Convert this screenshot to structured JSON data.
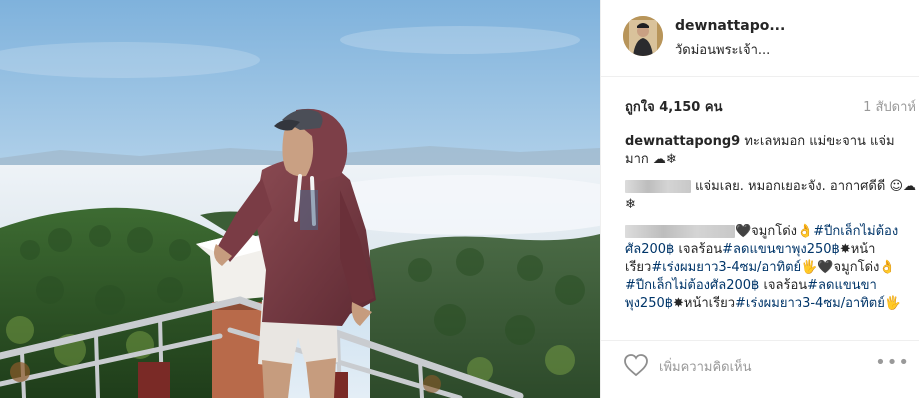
{
  "post": {
    "photo_icon": "photo",
    "username": "dewnattapo...",
    "location": "วัดม่อนพระเจ้า...",
    "likes": "ถูกใจ 4,150 คน",
    "time": "1 สัปดาห์",
    "add_comment_placeholder": "เพิ่มความคิดเห็น",
    "more_icon": "•••"
  },
  "comments": [
    {
      "user": "dewnattapong9",
      "text": " ทะเลหมอก แม่ขะจาน แจ่มมาก ☁❄"
    },
    {
      "text": "แจ่มเลย. หมอกเยอะจัง. อากาศดีดี ☺☁❄"
    },
    {
      "text1": "🖤จมูกโด่ง👌",
      "tag1": "#ปีกเล็กไม่ต้องศัล200฿",
      "text2": " เจลร้อน",
      "tag2": "#ลดแขนขาพุง250฿",
      "text3": "✸หน้าเรียว",
      "tag3": "#เร่งผมยาว3-4ซม/อาทิตย์",
      "text4": "🖐🖤จมูกโด่ง👌",
      "tag4": "#ปีกเล็กไม่ต้องศัล200฿",
      "text5": " เจลร้อน",
      "tag5": "#ลดแขนขาพุง250฿",
      "text6": "✸หน้าเรียว",
      "tag6": "#เร่งผมยาว3-4ซม/อาทิตย์",
      "text7": "🖐"
    }
  ]
}
